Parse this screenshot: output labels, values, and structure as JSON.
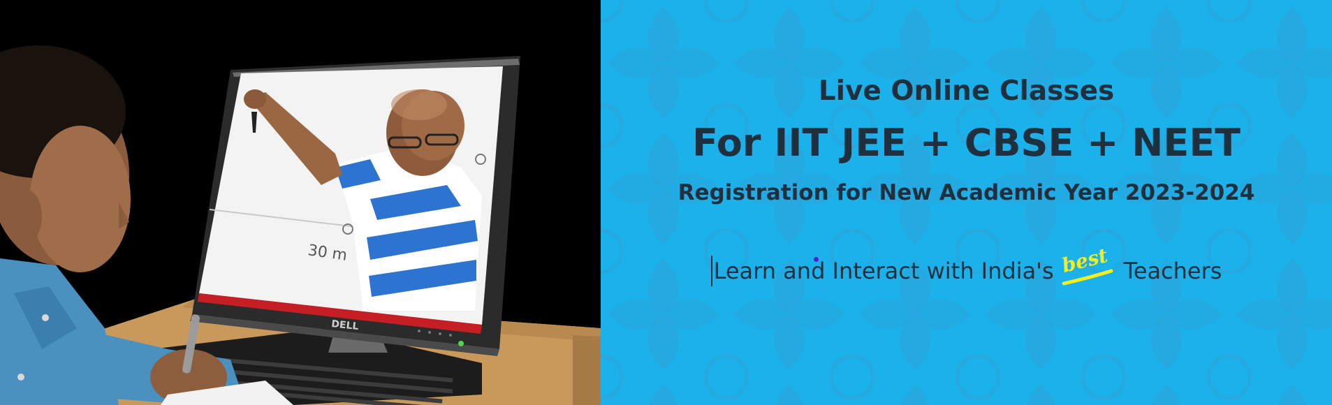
{
  "banner": {
    "headline": "Live Online Classes",
    "courses": "For IIT JEE + CBSE + NEET",
    "registration": "Registration for New Academic Year 2023-2024",
    "tagline_start": "Learn and Interact with India's",
    "tagline_badge": "best",
    "tagline_end": "Teachers",
    "monitor_brand": "DELL",
    "whiteboard_text": "30 m"
  },
  "colors": {
    "background_blue": "#1bb1ea",
    "text_dark": "#1e2f3d",
    "badge_yellow": "#f4ee1f",
    "photo_background": "#000000"
  },
  "icons": {
    "badge": "best-badge-icon"
  }
}
